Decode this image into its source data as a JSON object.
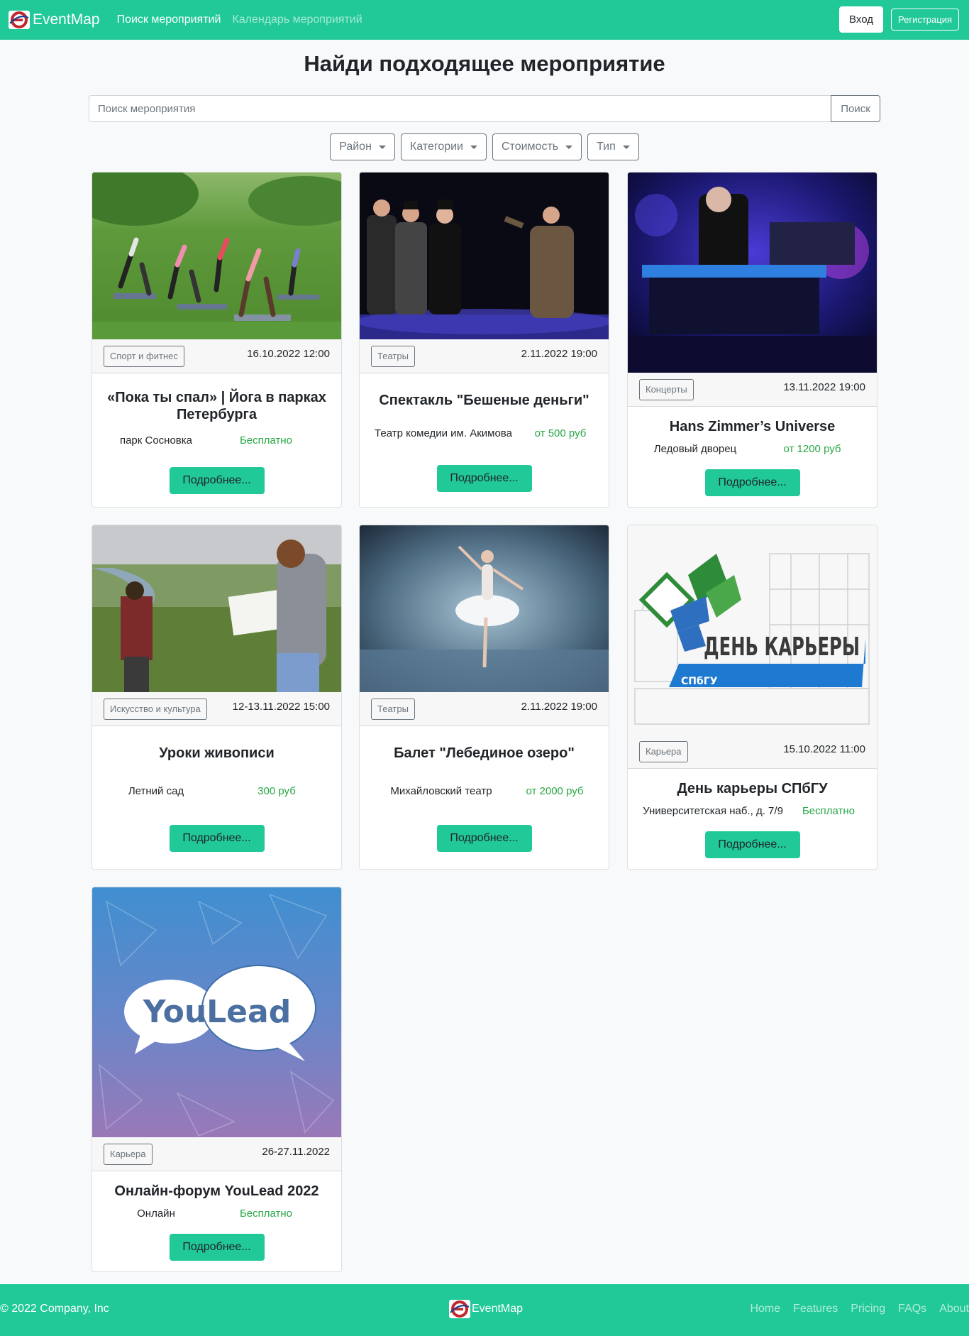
{
  "navbar": {
    "brand": "EventMap",
    "links": [
      {
        "label": "Поиск мероприятий",
        "active": true
      },
      {
        "label": "Календарь мероприятий",
        "active": false
      }
    ],
    "login_label": "Вход",
    "register_label": "Регистрация"
  },
  "main": {
    "title": "Найди подходящее мероприятие",
    "search": {
      "placeholder": "Поиск мероприятия",
      "value": "",
      "button_label": "Поиск"
    },
    "filters": [
      "Район",
      "Категории",
      "Стоимость",
      "Тип"
    ]
  },
  "colors": {
    "accent": "#20c997",
    "price": "#28a745",
    "badge": "#6c757d"
  },
  "events": [
    {
      "category": "Спорт и фитнес",
      "date": "16.10.2022 12:00",
      "title": "«Пока ты спал» | Йога в парках Петербурга",
      "place": "парк Сосновка",
      "price": "Бесплатно",
      "button": "Подробнее...",
      "image": "yoga-photo"
    },
    {
      "category": "Театры",
      "date": "2.11.2022 19:00",
      "title": "Спектакль \"Бешеные деньги\"",
      "place": "Театр комедии им. Акимова",
      "price": "от 500 руб",
      "button": "Подробнее...",
      "image": "theatre-photo"
    },
    {
      "category": "Концерты",
      "date": "13.11.2022 19:00",
      "title": "Hans Zimmer’s Universe",
      "place": "Ледовый дворец",
      "price": "от 1200 руб",
      "button": "Подробнее...",
      "image": "concert-photo"
    },
    {
      "category": "Искусство и культура",
      "date": "12-13.11.2022 15:00",
      "title": "Уроки живописи",
      "place": "Летний сад",
      "price": "300 руб",
      "button": "Подробнее...",
      "image": "painting-photo"
    },
    {
      "category": "Театры",
      "date": "2.11.2022 19:00",
      "title": "Балет \"Лебединое озеро\"",
      "place": "Михайловский театр",
      "price": "от 2000 руб",
      "button": "Подробнее...",
      "image": "ballet-photo"
    },
    {
      "category": "Карьера",
      "date": "15.10.2022 11:00",
      "title": "День карьеры СПбГУ",
      "place": "Университетская наб., д. 7/9",
      "price": "Бесплатно",
      "button": "Подробнее...",
      "image": "career-day-poster",
      "poster_text": "ДЕНЬ КАРЬЕРЫ",
      "poster_ribbon": "СПбГУ"
    },
    {
      "category": "Карьера",
      "date": "26-27.11.2022",
      "title": "Онлайн-форум YouLead 2022",
      "place": "Онлайн",
      "price": "Бесплатно",
      "button": "Подробнее...",
      "image": "youlead-poster",
      "poster_text": "YouLead"
    }
  ],
  "footer": {
    "copyright": "© 2022 Company, Inc",
    "brand": "EventMap",
    "links": [
      "Home",
      "Features",
      "Pricing",
      "FAQs",
      "About"
    ]
  }
}
